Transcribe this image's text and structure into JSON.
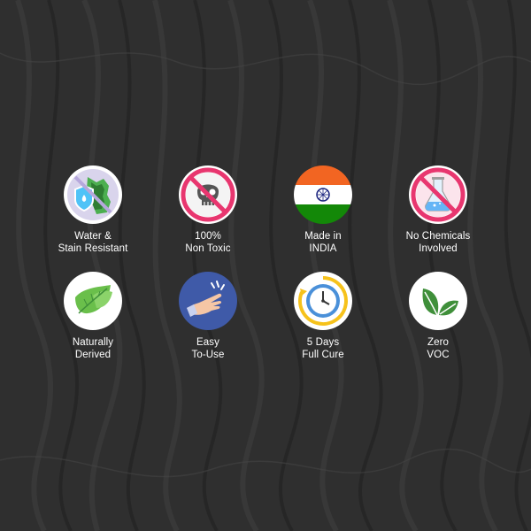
{
  "features": [
    {
      "icon": "water-stain-resistant-icon",
      "lines": [
        "Water &",
        "Stain Resistant"
      ]
    },
    {
      "icon": "non-toxic-skull-icon",
      "lines": [
        "100%",
        "Non Toxic"
      ]
    },
    {
      "icon": "india-flag-icon",
      "lines": [
        "Made in",
        "INDIA"
      ]
    },
    {
      "icon": "no-chemicals-flask-icon",
      "lines": [
        "No Chemicals",
        "Involved"
      ]
    },
    {
      "icon": "leaf-icon",
      "lines": [
        "Naturally",
        "Derived"
      ]
    },
    {
      "icon": "easy-hand-icon",
      "lines": [
        "Easy",
        "To-Use"
      ]
    },
    {
      "icon": "clock-cure-icon",
      "lines": [
        "5 Days",
        "Full Cure"
      ]
    },
    {
      "icon": "zero-voc-leaves-icon",
      "lines": [
        "Zero",
        "VOC"
      ]
    }
  ],
  "colors": {
    "background": "#2e2e2e",
    "text": "#ffffff",
    "prohibited_red": "#e8366f",
    "saffron": "#f26522",
    "india_green": "#138808",
    "leaf_green": "#3f8f3a",
    "easy_blue": "#3f5aa8",
    "clock_yellow": "#f6c21b"
  }
}
